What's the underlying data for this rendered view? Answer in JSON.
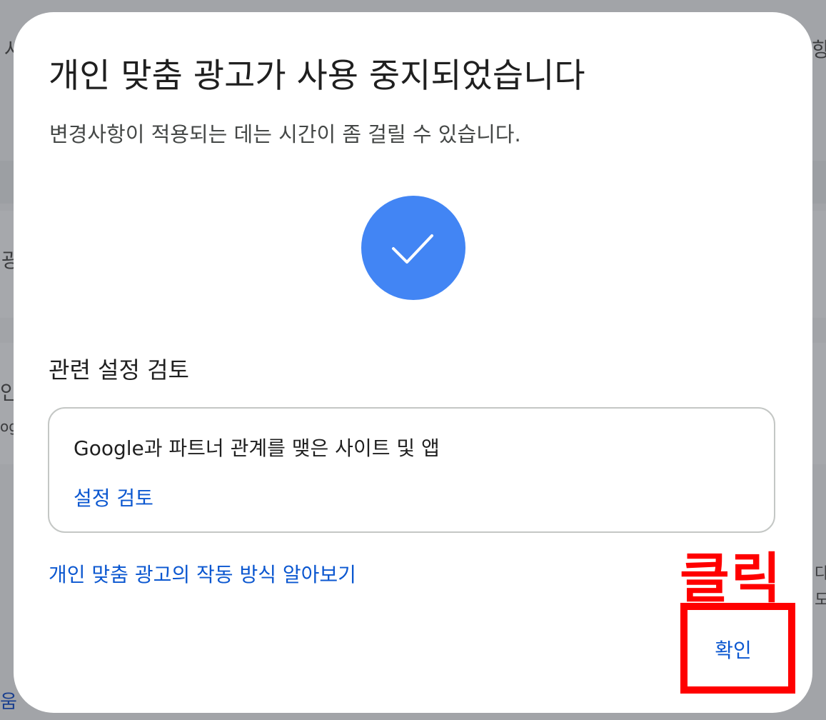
{
  "dialog": {
    "title": "개인 맞춤 광고가 사용 중지되었습니다",
    "subtitle": "변경사항이 적용되는 데는 시간이 좀 걸릴 수 있습니다.",
    "success_icon": "check-icon",
    "related_heading": "관련 설정 검토",
    "card": {
      "title": "Google과 파트너 관계를 맺은 사이트 및 앱",
      "link_label": "설정 검토"
    },
    "learn_link": "개인 맞춤 광고의 작동 방식 알아보기",
    "confirm_label": "확인"
  },
  "annotation": {
    "label": "클릭"
  },
  "background": {
    "fragments": [
      "사",
      "향",
      "광",
      "인",
      "og",
      "다",
      "도",
      "움"
    ]
  },
  "colors": {
    "accent_blue": "#4285f4",
    "link_blue": "#0b57d0",
    "annotation_red": "#ff0000"
  }
}
